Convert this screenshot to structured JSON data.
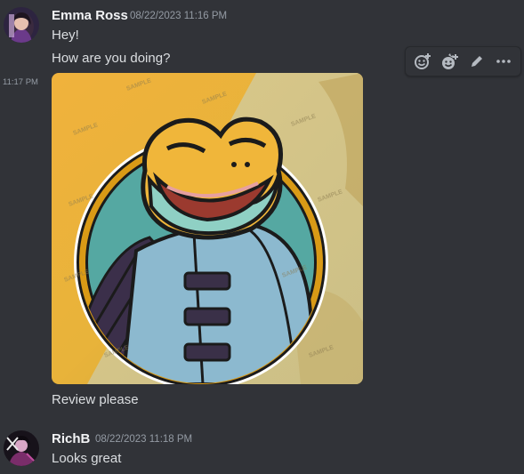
{
  "messages": {
    "first": {
      "author": "Emma Ross",
      "timestamp": "08/22/2023 11:16 PM",
      "lines": [
        "Hey!",
        "How are you doing?"
      ]
    },
    "followup": {
      "timestamp": "11:17 PM",
      "image_watermark": "SAMPLE",
      "caption": "Review please"
    },
    "second": {
      "author": "RichB",
      "timestamp": "08/22/2023 11:18 PM",
      "text": "Looks great"
    }
  },
  "toolbar": {
    "actions": [
      "add-reaction-icon",
      "super-reaction-icon",
      "edit-icon",
      "more-icon"
    ]
  },
  "colors": {
    "background": "#313338",
    "muted": "#949ba4",
    "ring": "#d99a16"
  }
}
